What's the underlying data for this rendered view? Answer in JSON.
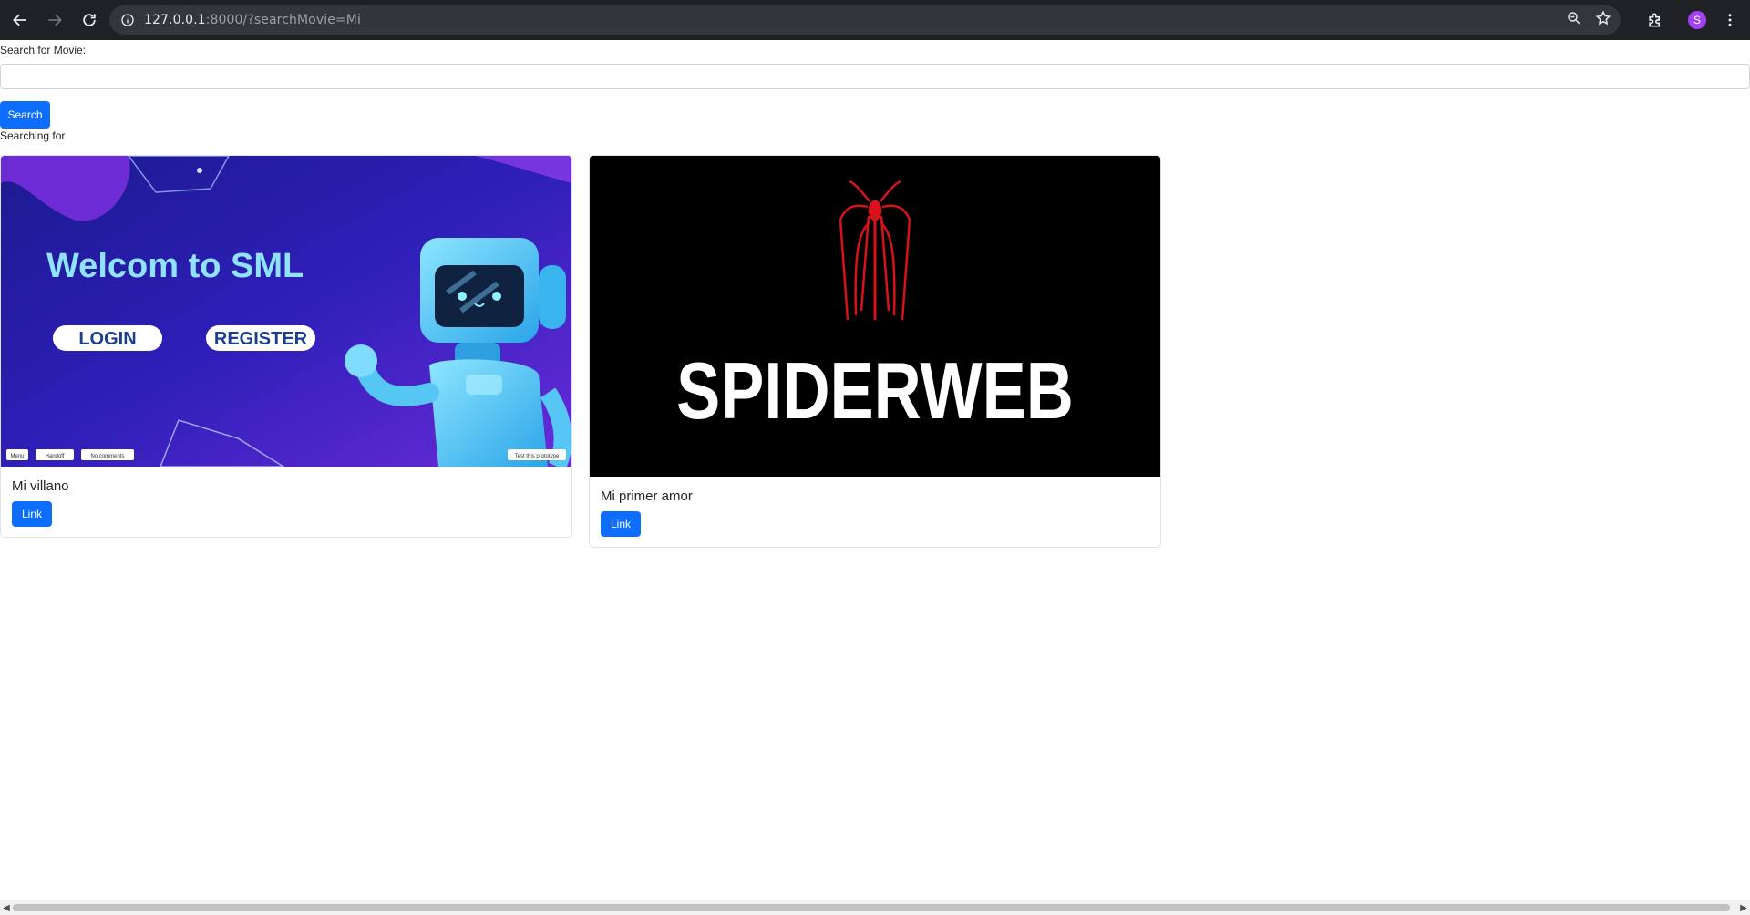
{
  "browser": {
    "url_host": "127.0.0.1",
    "url_rest": ":8000/?searchMovie=Mi",
    "profile_initial": "S"
  },
  "page": {
    "search_label": "Search for Movie:",
    "search_value": "",
    "search_button": "Search",
    "searching_for": "Searching for"
  },
  "movies": [
    {
      "title": "Mi villano",
      "link_label": "Link",
      "poster": {
        "headline": "Welcom to SML",
        "login": "LOGIN",
        "register": "REGISTER",
        "footer_left": [
          "Menu",
          "Handoff",
          "No comments"
        ],
        "footer_right": "Test this prototype"
      }
    },
    {
      "title": "Mi primer amor",
      "link_label": "Link",
      "poster": {
        "headline": "SPIDERWEB"
      }
    }
  ],
  "colors": {
    "primary": "#0d6efd",
    "chrome_bg": "#202124",
    "omnibox_bg": "#35363a",
    "avatar": "#a142f4"
  }
}
